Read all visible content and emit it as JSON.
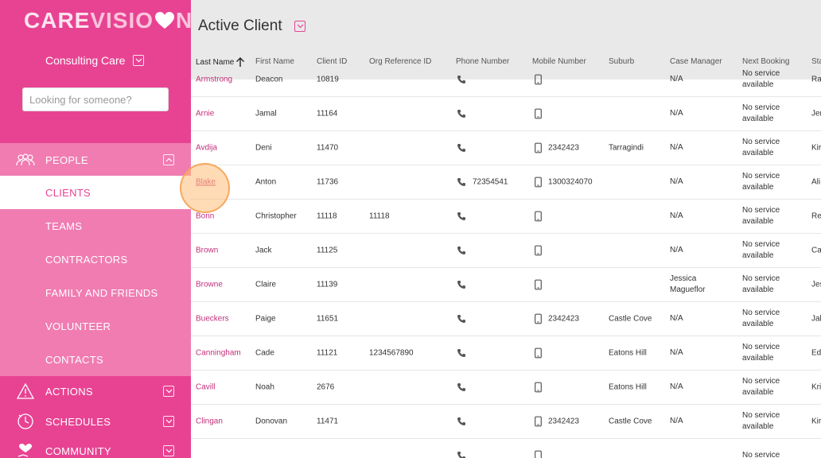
{
  "brand": {
    "care": "CARE",
    "vision_pre": "VISIO",
    "vision_post": "N"
  },
  "org": {
    "name": "Consulting Care"
  },
  "search": {
    "placeholder": "Looking for someone?"
  },
  "nav": {
    "people": "PEOPLE",
    "sub": [
      "CLIENTS",
      "TEAMS",
      "CONTRACTORS",
      "FAMILY AND FRIENDS",
      "VOLUNTEER",
      "CONTACTS"
    ],
    "actions": "ACTIONS",
    "schedules": "SCHEDULES",
    "community": "COMMUNITY"
  },
  "page": {
    "title": "Active Client"
  },
  "columns": [
    "Last Name",
    "First Name",
    "Client ID",
    "Org Reference ID",
    "Phone Number",
    "Mobile Number",
    "Suburb",
    "Case Manager",
    "Next Booking",
    "Sta"
  ],
  "rows": [
    {
      "last": "Armstrong",
      "first": "Deacon",
      "id": "10819",
      "org": "",
      "phone": "",
      "mobile": "",
      "suburb": "",
      "cm": "N/A",
      "nb": "No service available",
      "st": "Ra"
    },
    {
      "last": "Arnie",
      "first": "Jamal",
      "id": "11164",
      "org": "",
      "phone": "",
      "mobile": "",
      "suburb": "",
      "cm": "N/A",
      "nb": "No service available",
      "st": "Jer"
    },
    {
      "last": "Avdija",
      "first": "Deni",
      "id": "11470",
      "org": "",
      "phone": "",
      "mobile": "2342423",
      "suburb": "Tarragindi",
      "cm": "N/A",
      "nb": "No service available",
      "st": "Kir"
    },
    {
      "last": "Blake",
      "first": "Anton",
      "id": "11736",
      "org": "",
      "phone": "72354541",
      "mobile": "1300324070",
      "suburb": "",
      "cm": "N/A",
      "nb": "No service available",
      "st": "Ali"
    },
    {
      "last": "Bonn",
      "first": "Christopher",
      "id": "11118",
      "org": "11118",
      "phone": "",
      "mobile": "",
      "suburb": "",
      "cm": "N/A",
      "nb": "No service available",
      "st": "Re"
    },
    {
      "last": "Brown",
      "first": "Jack",
      "id": "11125",
      "org": "",
      "phone": "",
      "mobile": "",
      "suburb": "",
      "cm": "N/A",
      "nb": "No service available",
      "st": "Ca"
    },
    {
      "last": "Browne",
      "first": "Claire",
      "id": "11139",
      "org": "",
      "phone": "",
      "mobile": "",
      "suburb": "",
      "cm": "Jessica Magueflor",
      "nb": "No service available",
      "st": "Jes"
    },
    {
      "last": "Bueckers",
      "first": "Paige",
      "id": "11651",
      "org": "",
      "phone": "",
      "mobile": "2342423",
      "suburb": "Castle Cove",
      "cm": "N/A",
      "nb": "No service available",
      "st": "Jal"
    },
    {
      "last": "Canningham",
      "first": "Cade",
      "id": "11121",
      "org": "1234567890",
      "phone": "",
      "mobile": "",
      "suburb": "Eatons Hill",
      "cm": "N/A",
      "nb": "No service available",
      "st": "Ed"
    },
    {
      "last": "Cavill",
      "first": "Noah",
      "id": "2676",
      "org": "",
      "phone": "",
      "mobile": "",
      "suburb": "Eatons Hill",
      "cm": "N/A",
      "nb": "No service available",
      "st": "Kri"
    },
    {
      "last": "Clingan",
      "first": "Donovan",
      "id": "11471",
      "org": "",
      "phone": "",
      "mobile": "2342423",
      "suburb": "Castle Cove",
      "cm": "N/A",
      "nb": "No service available",
      "st": "Kir"
    },
    {
      "last": "",
      "first": "",
      "id": "",
      "org": "",
      "phone": "",
      "mobile": "",
      "suburb": "",
      "cm": "",
      "nb": "No service",
      "st": ""
    }
  ],
  "colors": {
    "brand": "#e84393",
    "sub_bg": "#f07cb2",
    "link": "#c2307a"
  }
}
